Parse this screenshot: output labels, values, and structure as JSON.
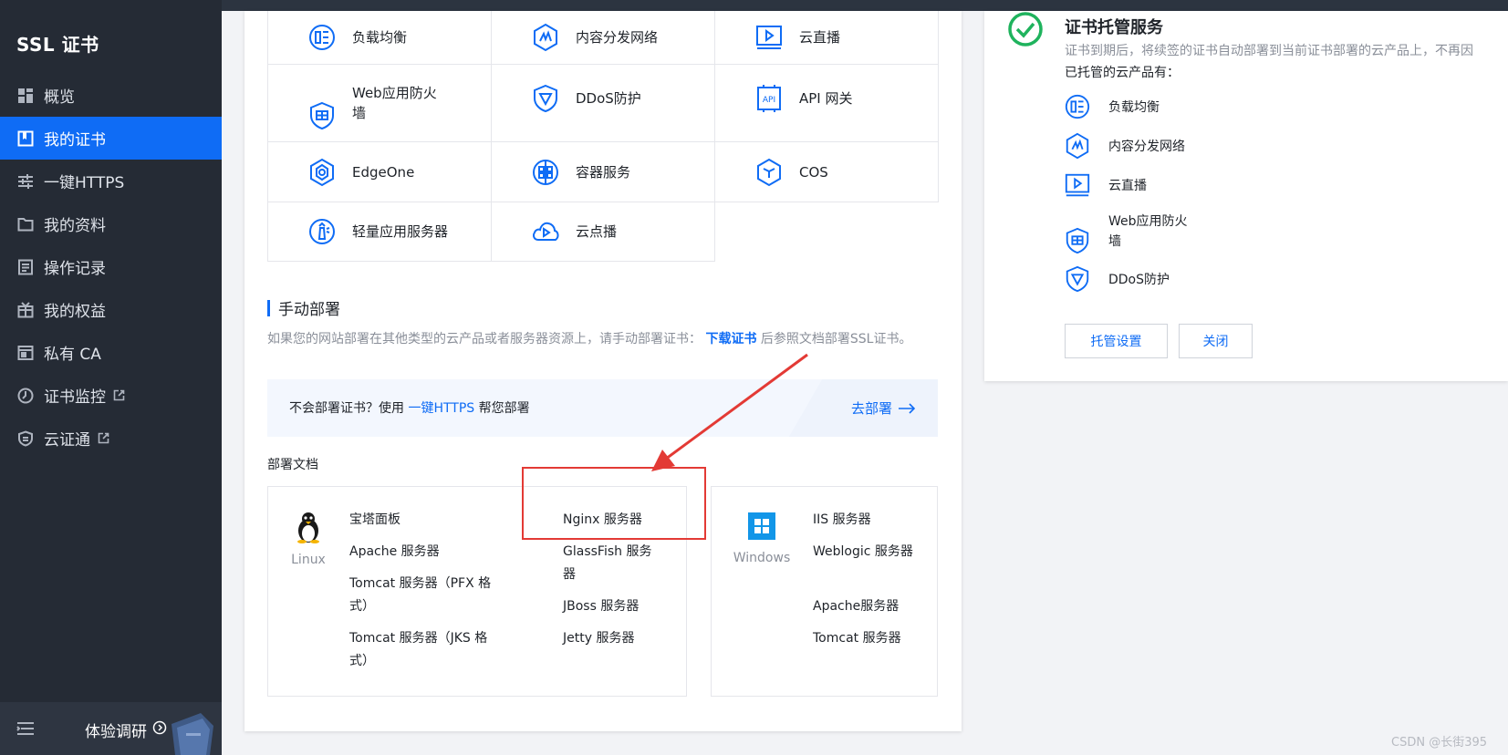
{
  "sidebar": {
    "brand": "SSL 证书",
    "items": [
      {
        "label": "概览",
        "icon": "dashboard-icon"
      },
      {
        "label": "我的证书",
        "icon": "certificate-icon",
        "active": true
      },
      {
        "label": "一键HTTPS",
        "icon": "sliders-icon"
      },
      {
        "label": "我的资料",
        "icon": "folder-icon"
      },
      {
        "label": "操作记录",
        "icon": "log-icon"
      },
      {
        "label": "我的权益",
        "icon": "gift-icon"
      },
      {
        "label": "私有 CA",
        "icon": "ca-icon"
      },
      {
        "label": "证书监控",
        "icon": "monitor-icon",
        "external": true
      },
      {
        "label": "云证通",
        "icon": "shield-icon",
        "external": true
      }
    ],
    "footer": {
      "survey_label": "体验调研"
    }
  },
  "products": [
    {
      "label": "负载均衡",
      "icon": "load-balancer-icon"
    },
    {
      "label": "内容分发网络",
      "icon": "cdn-icon"
    },
    {
      "label": "云直播",
      "icon": "live-stream-icon"
    },
    {
      "label": "Web应用防火墙",
      "icon": "waf-icon"
    },
    {
      "label": "DDoS防护",
      "icon": "ddos-icon"
    },
    {
      "label": "API 网关",
      "icon": "api-gateway-icon"
    },
    {
      "label": "EdgeOne",
      "icon": "edgeone-icon"
    },
    {
      "label": "容器服务",
      "icon": "container-icon"
    },
    {
      "label": "COS",
      "icon": "cos-icon"
    },
    {
      "label": "轻量应用服务器",
      "icon": "lighthouse-icon"
    },
    {
      "label": "云点播",
      "icon": "vod-icon"
    }
  ],
  "manual": {
    "title": "手动部署",
    "desc_prefix": "如果您的网站部署在其他类型的云产品或者服务器资源上，请手动部署证书：",
    "desc_link": "下载证书",
    "desc_suffix": "后参照文档部署SSL证书。",
    "banner_prefix": "不会部署证书？使用",
    "banner_link": "一键HTTPS",
    "banner_suffix": "帮您部署",
    "banner_go": "去部署"
  },
  "docs": {
    "label": "部署文档",
    "linux": {
      "os": "Linux",
      "col1": [
        "宝塔面板",
        "Apache 服务器",
        "Tomcat 服务器（PFX 格式）",
        "Tomcat 服务器（JKS 格式）"
      ],
      "col2": [
        "Nginx 服务器",
        "GlassFish 服务器",
        "JBoss 服务器",
        "Jetty 服务器"
      ]
    },
    "windows": {
      "os": "Windows",
      "items": [
        "IIS 服务器",
        "Weblogic 服务器",
        "Apache服务器",
        "Tomcat 服务器"
      ]
    }
  },
  "hosting": {
    "title": "证书托管服务",
    "desc": "证书到期后，将续签的证书自动部署到当前证书部署的云产品上，不再因",
    "subtitle": "已托管的云产品有：",
    "items": [
      {
        "label": "负载均衡",
        "icon": "load-balancer-icon"
      },
      {
        "label": "内容分发网络",
        "icon": "cdn-icon"
      },
      {
        "label": "云直播",
        "icon": "live-stream-icon"
      },
      {
        "label": "Web应用防火墙",
        "icon": "waf-icon"
      },
      {
        "label": "DDoS防护",
        "icon": "ddos-icon"
      }
    ],
    "settings_button": "托管设置",
    "close_button": "关闭"
  },
  "watermark": "CSDN @长街395",
  "colors": {
    "accent": "#0f6cf5",
    "sidebar": "#252b35",
    "highlight": "#e33a35",
    "success": "#1fb35d"
  }
}
